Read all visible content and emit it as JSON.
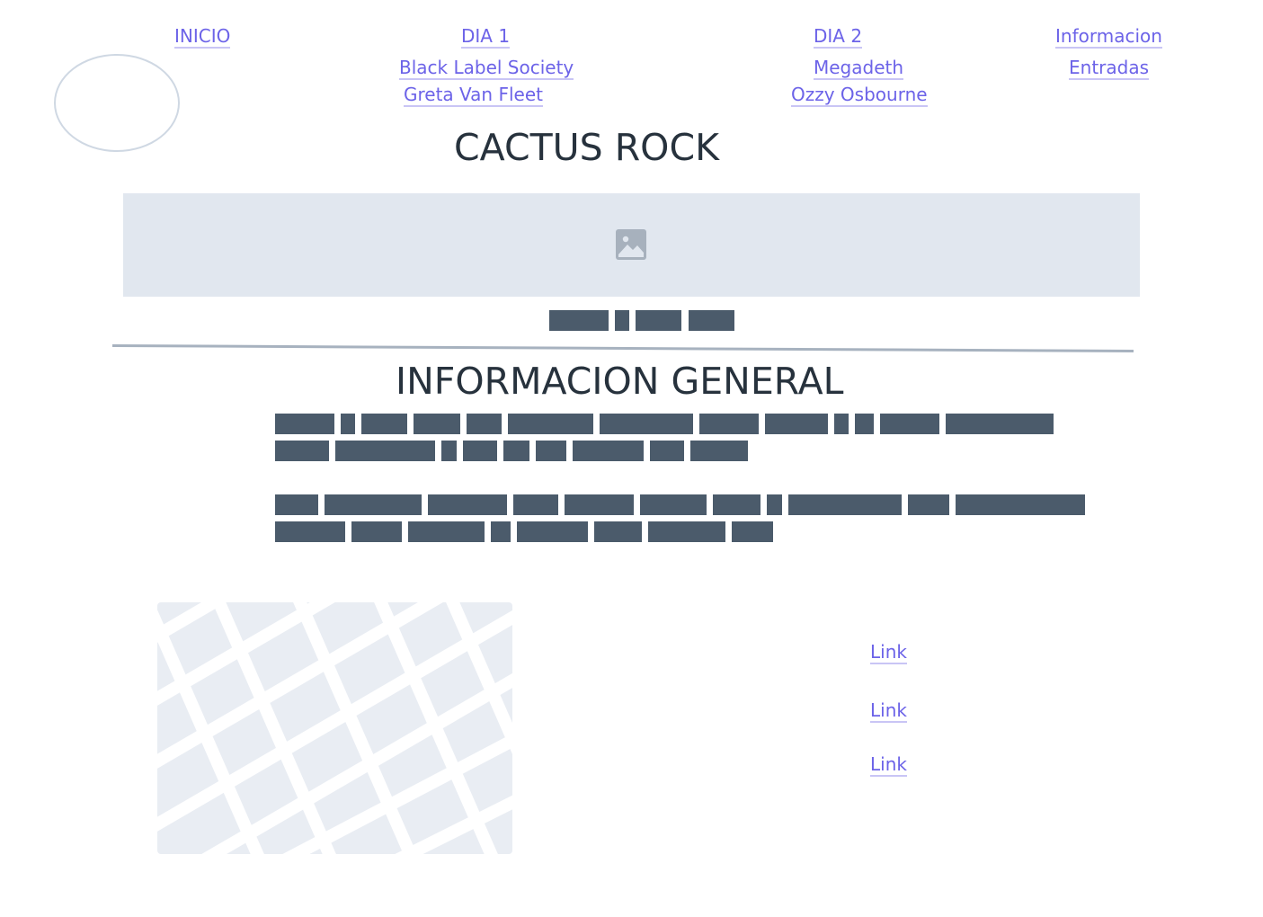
{
  "nav": {
    "inicio": "INICIO",
    "dia1": {
      "label": "DIA 1",
      "items": [
        "Black Label Society",
        "Greta Van Fleet"
      ]
    },
    "dia2": {
      "label": "DIA 2",
      "items": [
        "Megadeth",
        "Ozzy Osbourne"
      ]
    },
    "info": {
      "label": "Informacion",
      "items": [
        "Entradas"
      ]
    }
  },
  "site": {
    "title": "CACTUS ROCK"
  },
  "section": {
    "title": "INFORMACION GENERAL"
  },
  "links": [
    "Link",
    "Link",
    "Link"
  ],
  "colors": {
    "link": "#6c63e8",
    "placeholder_text": "#4b5b6b",
    "placeholder_bg": "#e1e7ef"
  },
  "icons": {
    "hero": "image-icon",
    "map": "map-placeholder"
  }
}
